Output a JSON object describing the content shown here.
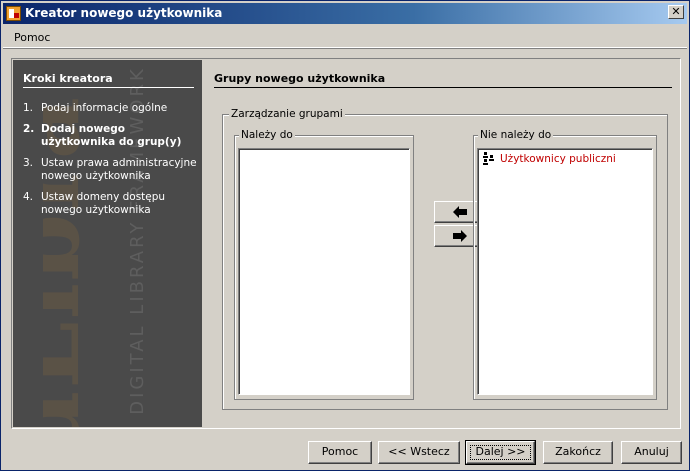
{
  "window": {
    "title": "Kreator nowego użytkownika",
    "close_symbol": "✕"
  },
  "menu": {
    "items": [
      "Pomoc"
    ]
  },
  "sidebar": {
    "heading": "Kroki kreatora",
    "steps": [
      {
        "num": "1.",
        "label": "Podaj informacje ogólne",
        "current": false
      },
      {
        "num": "2.",
        "label": "Dodaj nowego użytkownika do grup(y)",
        "current": true
      },
      {
        "num": "3.",
        "label": "Ustaw prawa administracyjne nowego użytkownika",
        "current": false
      },
      {
        "num": "4.",
        "label": "Ustaw domeny dostępu nowego użytkownika",
        "current": false
      }
    ],
    "watermark_logo": "dLibra",
    "watermark_text": "DIGITAL LIBRARY FRAMEWORK"
  },
  "main": {
    "heading": "Grupy nowego użytkownika",
    "group_box_label": "Zarządzanie grupami",
    "member_of": {
      "label": "Należy do",
      "items": []
    },
    "not_member_of": {
      "label": "Nie należy do",
      "items": [
        {
          "label": "Użytkownicy publiczni",
          "icon": "group-icon"
        }
      ]
    },
    "move_left_icon": "arrow-left-icon",
    "move_right_icon": "arrow-right-icon"
  },
  "buttons": {
    "help": "Pomoc",
    "back": "<< Wstecz",
    "next": "Dalej >>",
    "finish": "Zakończ",
    "cancel": "Anuluj"
  },
  "colors": {
    "titlebar_start": "#0a246a",
    "sidebar_bg": "#4a4a4a",
    "item_text": "#c00000",
    "face": "#d4d0c8"
  }
}
